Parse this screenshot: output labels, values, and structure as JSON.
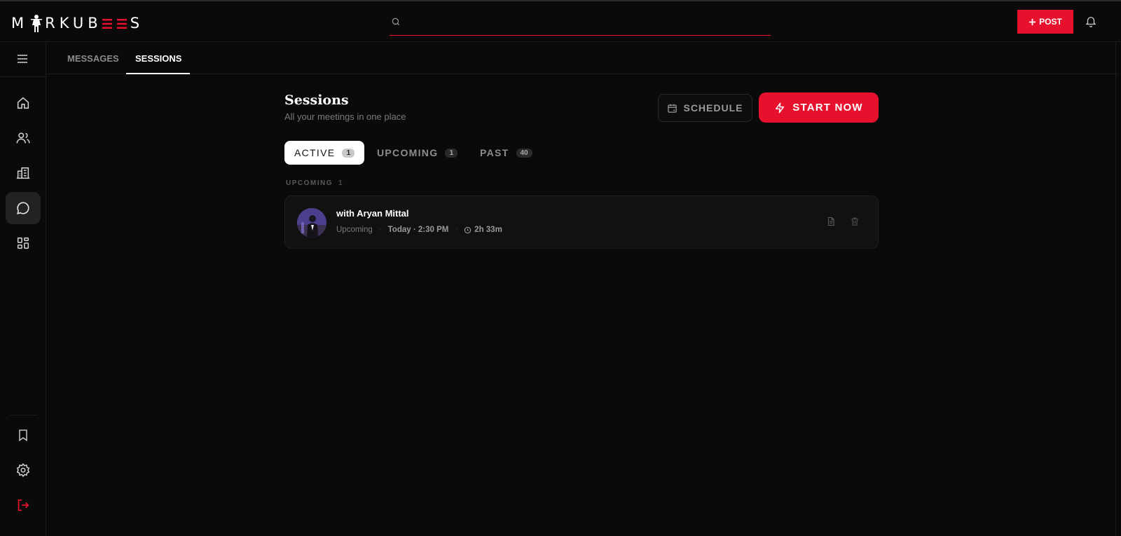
{
  "app": {
    "logo_text_left": "M",
    "logo_text_mid": "RKUB",
    "logo_text_red": "EE",
    "logo_text_end": "S"
  },
  "search": {
    "placeholder": "",
    "value": ""
  },
  "header_actions": {
    "post_label": "POST",
    "post_icon": "plus-icon",
    "bell_icon": "bell-icon"
  },
  "sidebar": {
    "menu_icon": "menu-icon",
    "items": [
      {
        "icon": "home-icon",
        "active": false
      },
      {
        "icon": "users-icon",
        "active": false
      },
      {
        "icon": "building-icon",
        "active": false
      },
      {
        "icon": "message-circle-icon",
        "active": true
      },
      {
        "icon": "grid-icon",
        "active": false
      }
    ],
    "bottom_items": [
      {
        "icon": "bookmark-icon"
      },
      {
        "icon": "gear-icon"
      },
      {
        "icon": "logout-icon"
      }
    ]
  },
  "tabs": [
    {
      "label": "MESSAGES",
      "active": false
    },
    {
      "label": "SESSIONS",
      "active": true
    }
  ],
  "sessions": {
    "title": "Sessions",
    "subtitle": "All your meetings in one place",
    "schedule_label": "SCHEDULE",
    "start_label": "START NOW",
    "filters": [
      {
        "label": "ACTIVE",
        "count": "1",
        "active": true
      },
      {
        "label": "UPCOMING",
        "count": "1",
        "active": false
      },
      {
        "label": "PAST",
        "count": "40",
        "active": false
      }
    ],
    "section_label": "UPCOMING",
    "section_count": "1",
    "items": [
      {
        "title": "with Aryan Mittal",
        "status": "Upcoming",
        "when": "Today · 2:30 PM",
        "duration": "2h 33m"
      }
    ]
  },
  "colors": {
    "accent": "#e8112d",
    "background": "#0a0a0a",
    "card": "#111112"
  }
}
